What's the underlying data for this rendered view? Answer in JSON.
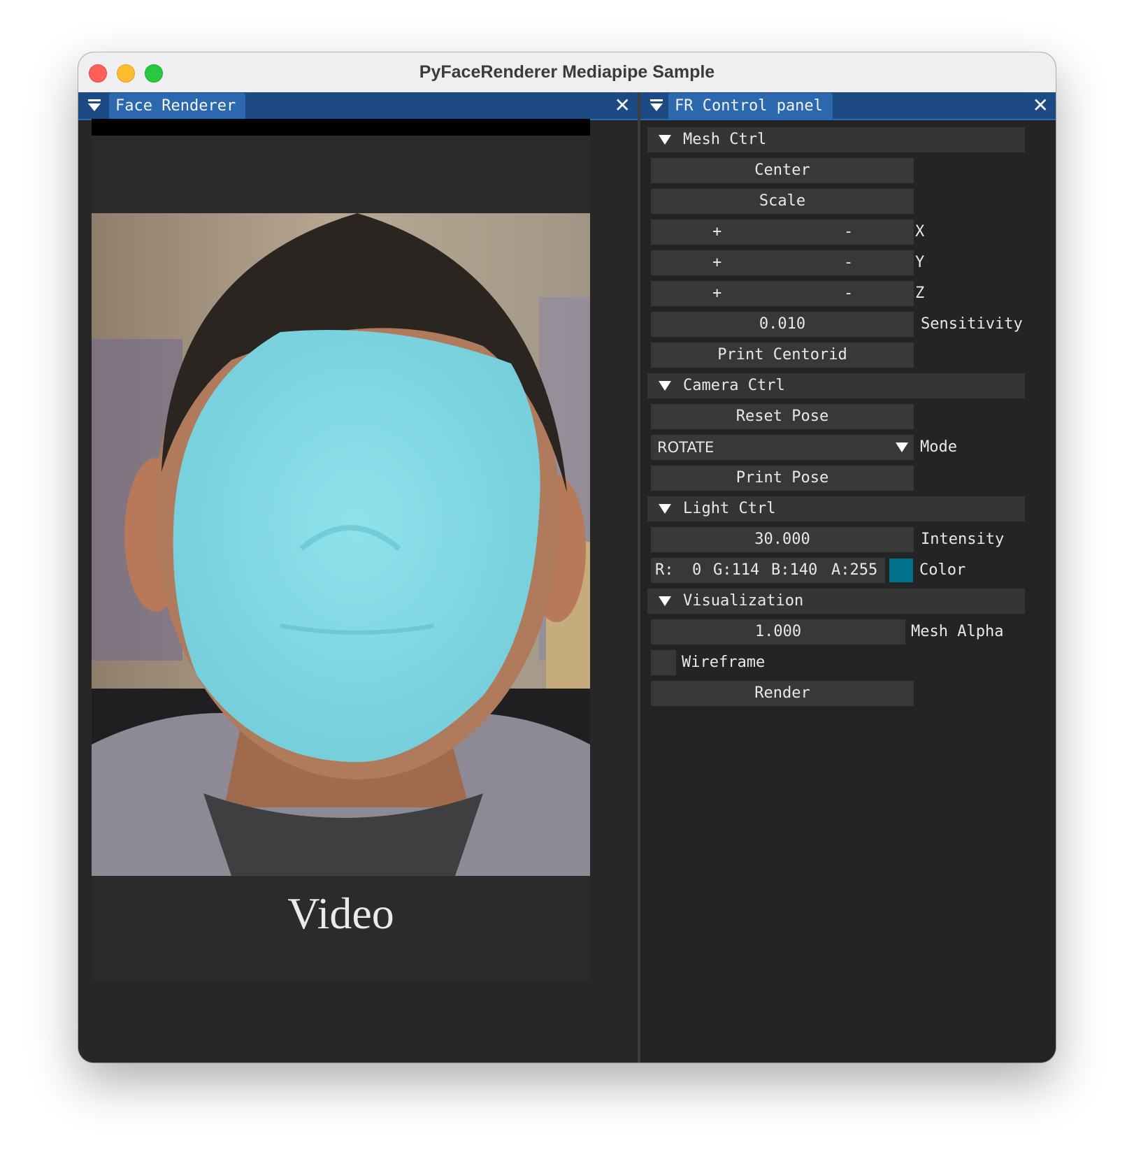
{
  "window": {
    "title": "PyFaceRenderer Mediapipe Sample"
  },
  "left_panel": {
    "tab_label": "Face Renderer",
    "caption": "Video"
  },
  "right_panel": {
    "tab_label": "FR Control panel",
    "mesh_ctrl": {
      "header": "Mesh Ctrl",
      "center_label": "Center",
      "scale_label": "Scale",
      "plus": "+",
      "minus": "-",
      "axis_x": "X",
      "axis_y": "Y",
      "axis_z": "Z",
      "sensitivity_value": "0.010",
      "sensitivity_label": "Sensitivity",
      "print_centroid_label": "Print Centorid"
    },
    "camera_ctrl": {
      "header": "Camera Ctrl",
      "reset_pose_label": "Reset Pose",
      "mode_value": "ROTATE",
      "mode_label": "Mode",
      "print_pose_label": "Print Pose"
    },
    "light_ctrl": {
      "header": "Light Ctrl",
      "intensity_value": "30.000",
      "intensity_label": "Intensity",
      "r": "R:  0",
      "g": "G:114",
      "b": "B:140",
      "a": "A:255",
      "color_swatch": "#00728c",
      "color_label": "Color"
    },
    "visualization": {
      "header": "Visualization",
      "mesh_alpha_value": "1.000",
      "mesh_alpha_label": "Mesh Alpha",
      "wireframe_label": "Wireframe",
      "wireframe_checked": false,
      "render_label": "Render"
    }
  },
  "colors": {
    "accent": "#2c68ad",
    "mesh": "#86dbe6"
  }
}
